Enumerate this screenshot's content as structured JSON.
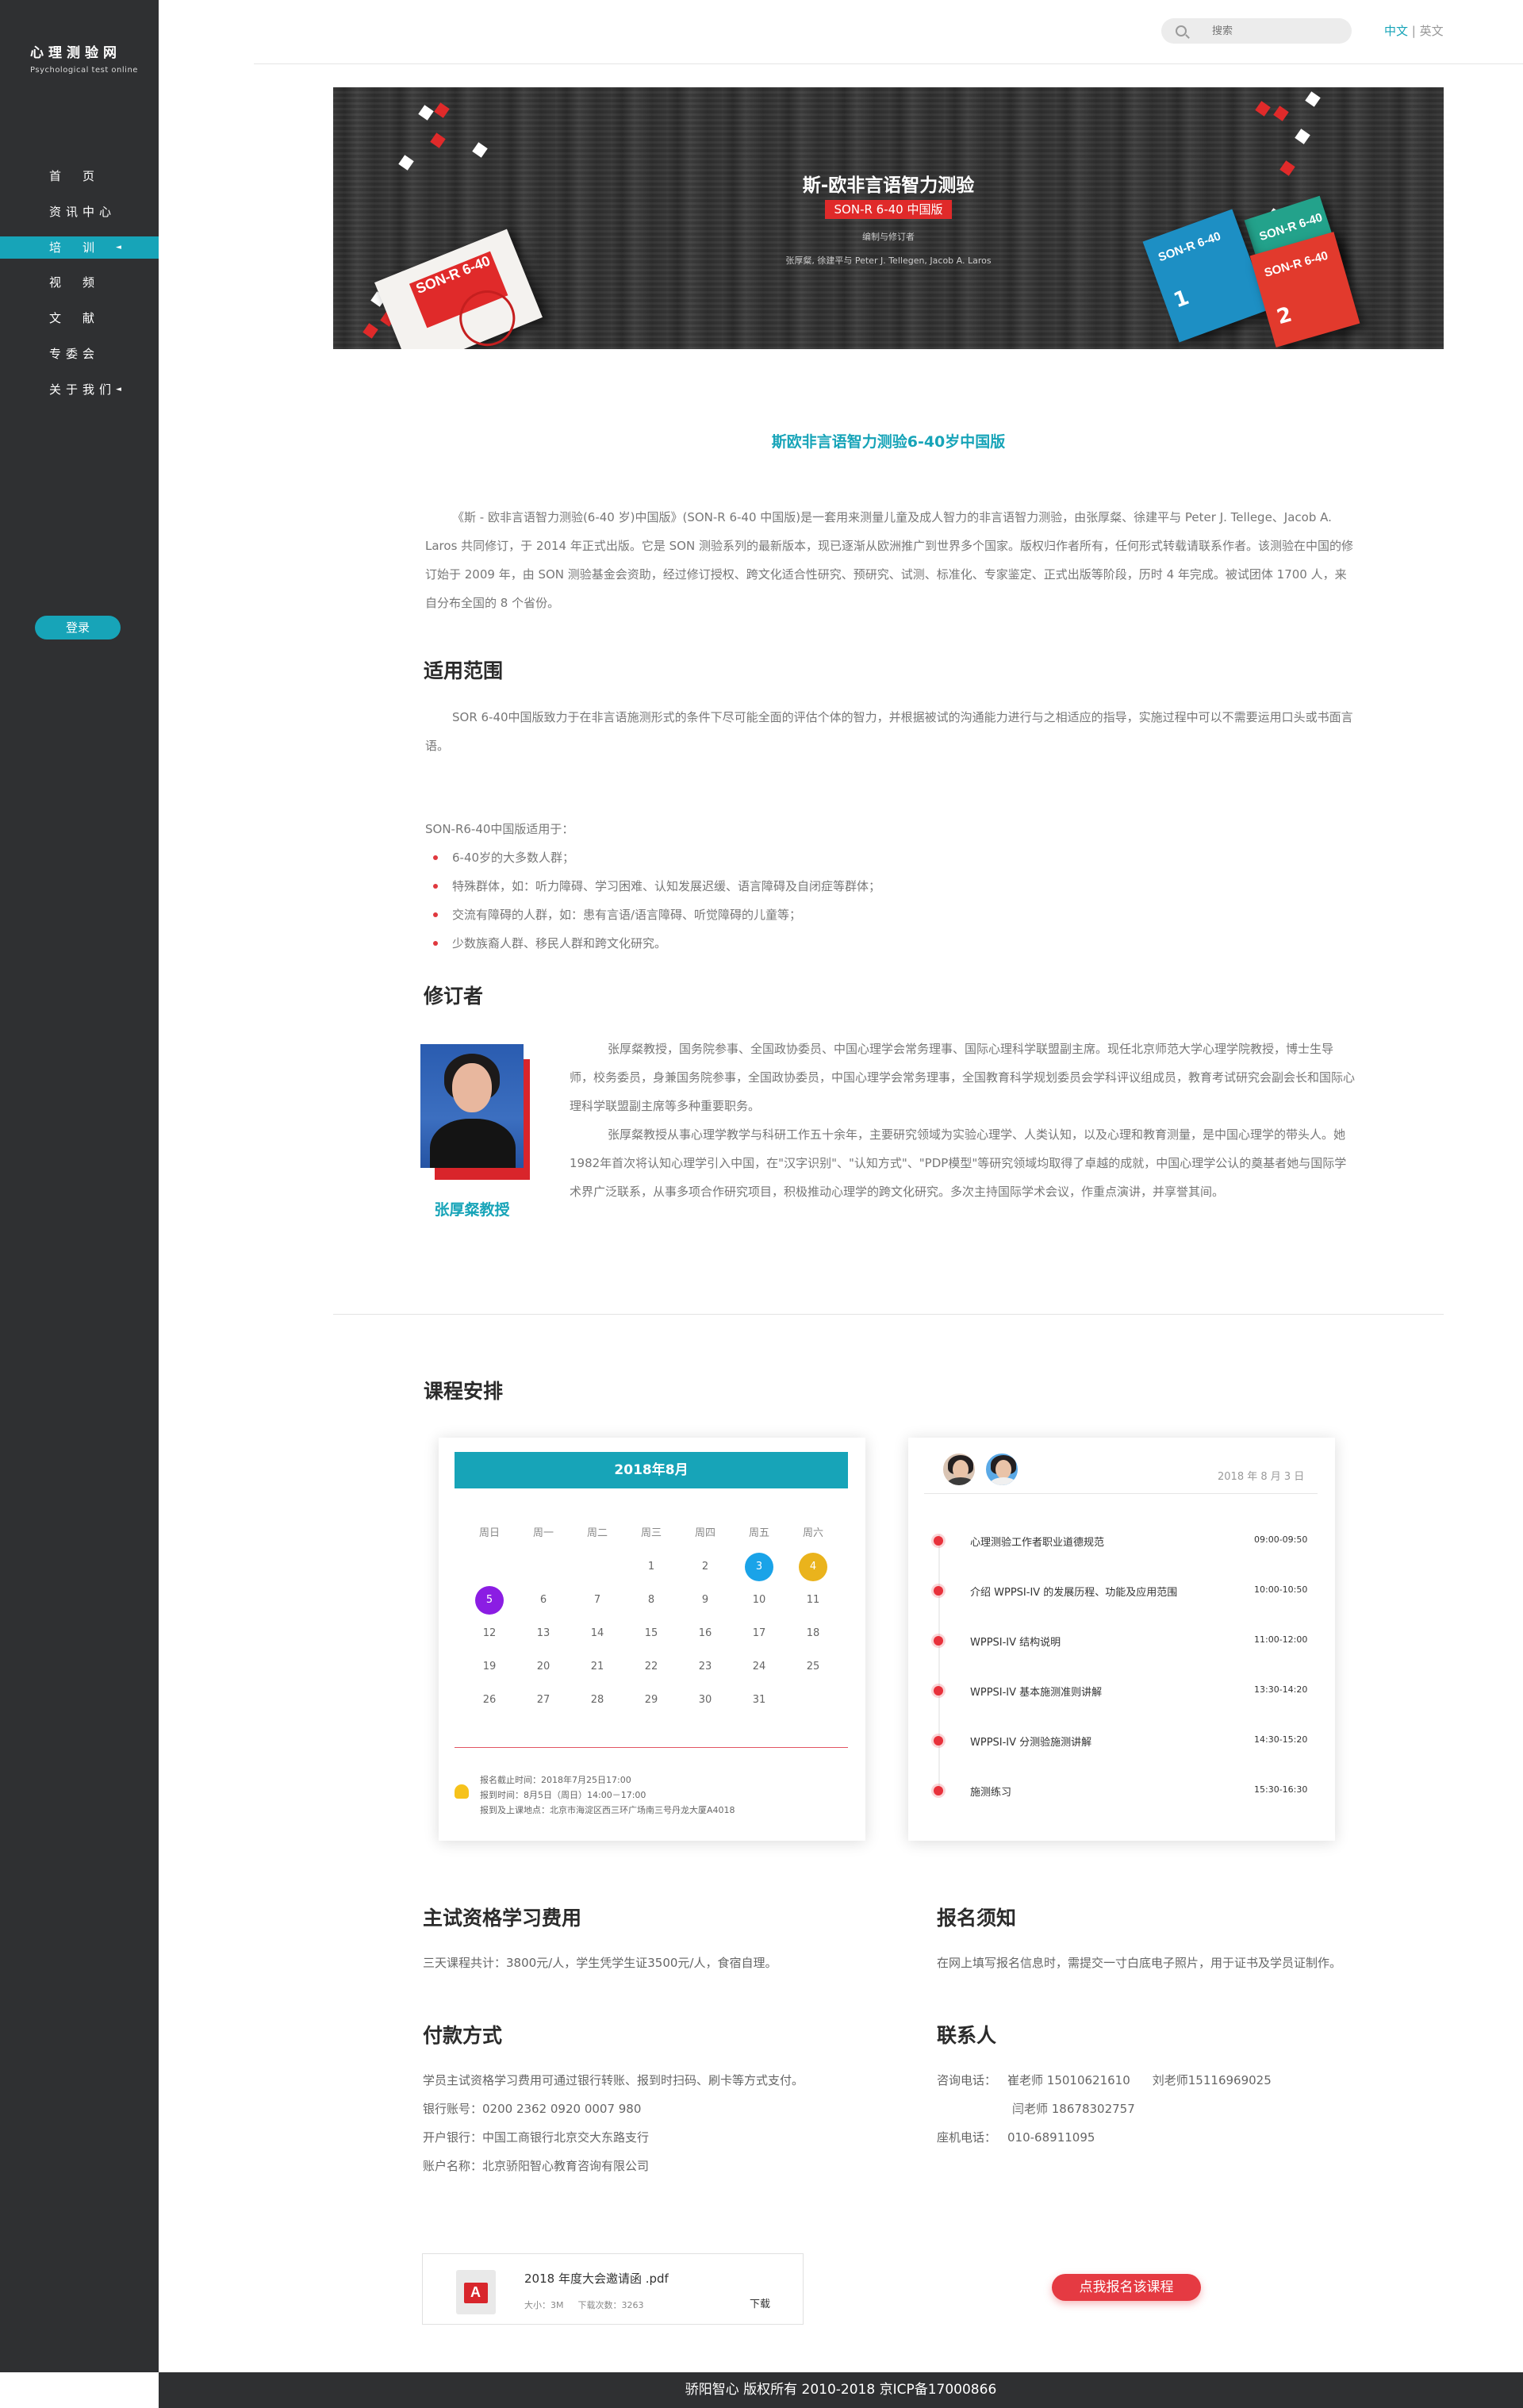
{
  "site": {
    "logo_cn": "心理测验网",
    "logo_en": "Psychological test online"
  },
  "nav": [
    {
      "label": "首　页",
      "arrow": ""
    },
    {
      "label": "资讯中心",
      "arrow": ""
    },
    {
      "label": "培　训",
      "arrow": "◄"
    },
    {
      "label": "视　频",
      "arrow": ""
    },
    {
      "label": "文　献",
      "arrow": ""
    },
    {
      "label": "专委会",
      "arrow": ""
    },
    {
      "label": "关于我们",
      "arrow": "◄"
    }
  ],
  "login_label": "登录",
  "search": {
    "placeholder": "搜索"
  },
  "lang": {
    "cn": "中文",
    "sep": "|",
    "en": "英文"
  },
  "banner": {
    "title": "斯-欧非言语智力测验",
    "badge": "SON-R 6-40 中国版",
    "sub": "编制与修订者",
    "authors": "张厚粲, 徐建平与 Peter J. Tellegen, Jacob A. Laros",
    "book_title": "SON-R 6-40",
    "book_blue": "SON-R 6-40",
    "book_red": "SON-R 6-40",
    "book_green": "SON-R 6-40",
    "num1": "1",
    "num2": "2"
  },
  "content_title": "斯欧非言语智力测验6-40岁中国版",
  "intro": "《斯 - 欧非言语智力测验(6-40 岁)中国版》(SON-R 6-40 中国版)是一套用来测量儿童及成人智力的非言语智力测验，由张厚粲、徐建平与 Peter J. Tellege、Jacob A. Laros 共同修订，于 2014 年正式出版。它是 SON 测验系列的最新版本，现已逐渐从欧洲推广到世界多个国家。版权归作者所有，任何形式转载请联系作者。该测验在中国的修订始于 2009 年，由 SON 测验基金会资助，经过修订授权、跨文化适合性研究、预研究、试测、标准化、专家鉴定、正式出版等阶段，历时 4 年完成。被试团体 1700 人，来自分布全国的 8 个省份。",
  "scope": {
    "heading": "适用范围",
    "text": "SOR 6-40中国版致力于在非言语施测形式的条件下尽可能全面的评估个体的智力，并根据被试的沟通能力进行与之相适应的指导，实施过程中可以不需要运用口头或书面言语。",
    "list_title": "SON-R6-40中国版适用于：",
    "items": [
      "6-40岁的大多数人群；",
      "特殊群体，如：听力障碍、学习困难、认知发展迟缓、语言障碍及自闭症等群体；",
      "交流有障碍的人群，如：患有言语/语言障碍、听觉障碍的儿童等；",
      "少数族裔人群、移民人群和跨文化研究。"
    ]
  },
  "reviser": {
    "heading": "修订者",
    "name": "张厚粲教授",
    "bio1": "张厚粲教授，国务院参事、全国政协委员、中国心理学会常务理事、国际心理科学联盟副主席。现任北京师范大学心理学院教授，博士生导师，校务委员，身兼国务院参事，全国政协委员，中国心理学会常务理事，全国教育科学规划委员会学科评议组成员，教育考试研究会副会长和国际心理科学联盟副主席等多种重要职务。",
    "bio2": "张厚粲教授从事心理学教学与科研工作五十余年，主要研究领域为实验心理学、人类认知，以及心理和教育测量，是中国心理学的带头人。她1982年首次将认知心理学引入中国，在\"汉字识别\"、\"认知方式\"、\"PDP模型\"等研究领域均取得了卓越的成就，中国心理学公认的奠基者她与国际学术界广泛联系，从事多项合作研究项目，积极推动心理学的跨文化研究。多次主持国际学术会议，作重点演讲，并享誉其间。"
  },
  "course": {
    "heading": "课程安排",
    "calendar": {
      "month": "2018年8月",
      "weekdays": [
        "周日",
        "周一",
        "周二",
        "周三",
        "周四",
        "周五",
        "周六"
      ],
      "weeks": [
        [
          "",
          "",
          "",
          "1",
          "2",
          "3",
          "4"
        ],
        [
          "5",
          "6",
          "7",
          "8",
          "9",
          "10",
          "11"
        ],
        [
          "12",
          "13",
          "14",
          "15",
          "16",
          "17",
          "18"
        ],
        [
          "19",
          "20",
          "21",
          "22",
          "23",
          "24",
          "25"
        ],
        [
          "26",
          "27",
          "28",
          "29",
          "30",
          "31",
          ""
        ]
      ],
      "highlights": {
        "3": "#1aa3e8",
        "4": "#eab31c",
        "5": "#8b1de3"
      },
      "info1": "报名截止时间：2018年7月25日17:00",
      "info2": "报到时间：8月5日（周日）14:00－17:00",
      "info3": "报到及上课地点：北京市海淀区西三环广场南三号丹龙大厦A4018"
    },
    "schedule": {
      "date": "2018 年 8 月 3 日",
      "items": [
        {
          "title": "心理测验工作者职业道德规范",
          "time": "09:00-09:50"
        },
        {
          "title": "介绍 WPPSI-IV 的发展历程、功能及应用范围",
          "time": "10:00-10:50"
        },
        {
          "title": "WPPSI-IV 结构说明",
          "time": "11:00-12:00"
        },
        {
          "title": "WPPSI-IV 基本施测准则讲解",
          "time": "13:30-14:20"
        },
        {
          "title": "WPPSI-IV 分测验施测讲解",
          "time": "14:30-15:20"
        },
        {
          "title": "施测练习",
          "time": "15:30-16:30"
        }
      ]
    }
  },
  "fee": {
    "heading": "主试资格学习费用",
    "text": "三天课程共计：3800元/人，学生凭学生证3500元/人，食宿自理。"
  },
  "notice": {
    "heading": "报名须知",
    "text": "在网上填写报名信息时，需提交一寸白底电子照片，用于证书及学员证制作。"
  },
  "payment": {
    "heading": "付款方式",
    "line1": "学员主试资格学习费用可通过银行转账、报到时扫码、刷卡等方式支付。",
    "line2": "银行账号：0200 2362 0920 0007 980",
    "line3": "开户银行：中国工商银行北京交大东路支行",
    "line4": "账户名称：北京骄阳智心教育咨询有限公司"
  },
  "contact": {
    "heading": "联系人",
    "phone_label": "咨询电话：",
    "phone1": "崔老师 15010621610",
    "phone2": "刘老师15116969025",
    "phone3": "闫老师 18678302757",
    "landline_label": "座机电话：",
    "landline": "010-68911095"
  },
  "download": {
    "name": "2018 年度大会邀请函 .pdf",
    "size": "大小：3M",
    "count": "下载次数：3263",
    "btn": "下载",
    "icon_letter": "A"
  },
  "signup_label": "点我报名该课程",
  "footer": "骄阳智心 版权所有 2010-2018 京ICP备17000866",
  "colors": {
    "accent": "#17a4b8",
    "red": "#e53a42",
    "sidebar": "#2f3032"
  }
}
